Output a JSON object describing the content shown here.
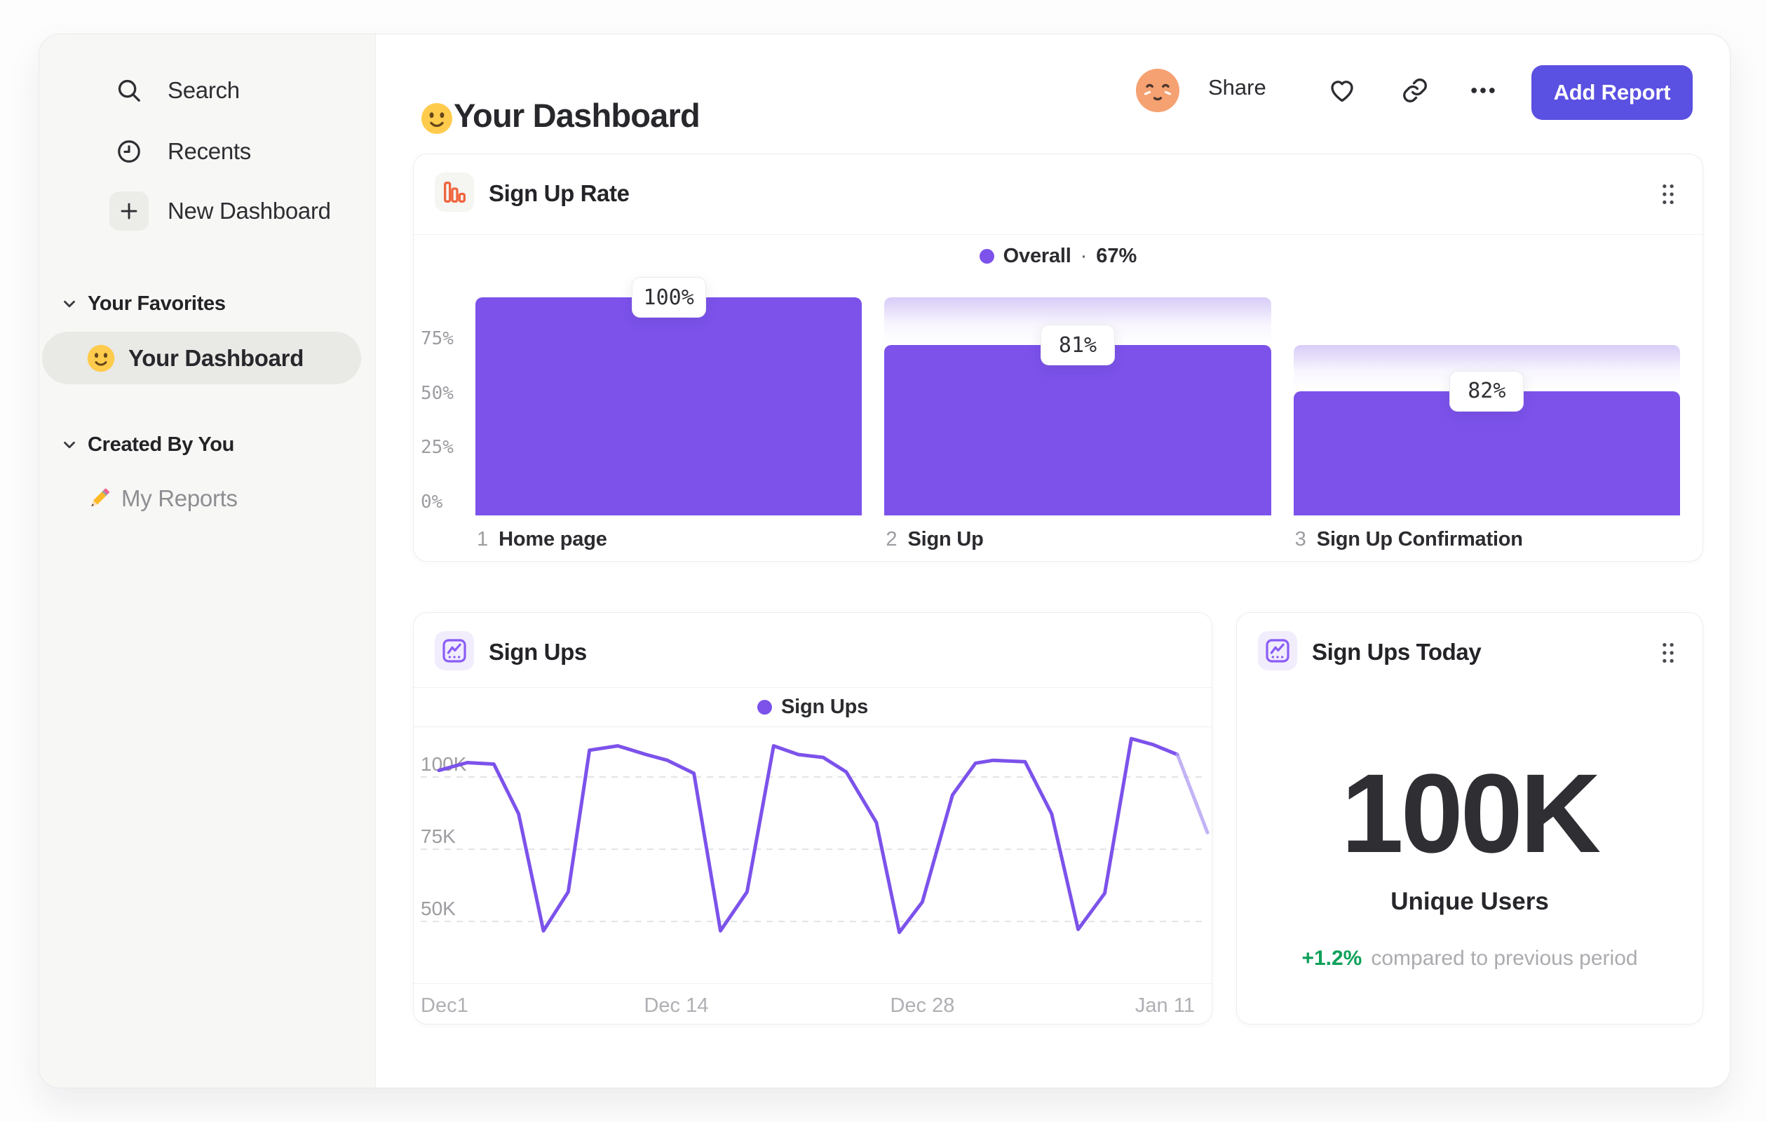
{
  "colors": {
    "purple": "#7C52EB",
    "indigo": "#5A50E1",
    "green": "#0EA05B",
    "orange": "#F0663F",
    "ghost_top": "#D8CCF8",
    "sidebar_bg": "#F7F7F5",
    "active_pill": "#E9E9E6"
  },
  "sidebar": {
    "nav": [
      {
        "label": "Search",
        "icon": "search-icon"
      },
      {
        "label": "Recents",
        "icon": "clock-icon"
      },
      {
        "label": "New Dashboard",
        "icon": "plus-icon"
      }
    ],
    "sections": [
      {
        "label": "Your Favorites",
        "items": [
          {
            "label": "Your Dashboard",
            "emoji": "slightly-smiling-face",
            "active": true
          }
        ]
      },
      {
        "label": "Created By You",
        "items": [
          {
            "label": "My Reports",
            "emoji": "pencil",
            "active": false
          }
        ]
      }
    ]
  },
  "header": {
    "emoji": "slightly-smiling-face",
    "title": "Your Dashboard",
    "share": "Share",
    "add_report": "Add Report"
  },
  "chart_data": [
    {
      "type": "bar",
      "title": "Sign Up Rate",
      "legend": {
        "label": "Overall",
        "sep": "·",
        "value": "67%"
      },
      "y_ticks": [
        "75%",
        "50%",
        "25%",
        "0%"
      ],
      "y_tick_fracs": [
        0.75,
        0.5,
        0.25,
        0
      ],
      "ylim": [
        0,
        100
      ],
      "steps": [
        {
          "num": "1",
          "label": "Home page",
          "value_label": "100%",
          "value": 100,
          "solid": 1.0,
          "ghost": null
        },
        {
          "num": "2",
          "label": "Sign Up",
          "value_label": "81%",
          "value": 81,
          "solid": 0.78,
          "ghost": 1.0
        },
        {
          "num": "3",
          "label": "Sign Up Confirmation",
          "value_label": "82%",
          "value": 82,
          "solid": 0.57,
          "ghost": 0.78
        }
      ],
      "bar_color": "#7C52EB"
    },
    {
      "type": "line",
      "title": "Sign Ups",
      "legend": {
        "label": "Sign Ups"
      },
      "x_domain": [
        0,
        43.4
      ],
      "y_domain": [
        28.4,
        117.2
      ],
      "y_ticks": [
        {
          "label": "100K",
          "value": 100
        },
        {
          "label": "75K",
          "value": 75
        },
        {
          "label": "50K",
          "value": 50
        }
      ],
      "x_ticks": [
        {
          "label": "Dec1",
          "day": 0,
          "align": "left"
        },
        {
          "label": "Dec 14",
          "day": 13.4
        },
        {
          "label": "Dec 28",
          "day": 27.3
        },
        {
          "label": "Jan 11",
          "day": 41
        }
      ],
      "unit": "K",
      "points": [
        [
          0,
          102
        ],
        [
          1.6,
          104.7
        ],
        [
          3.1,
          104.2
        ],
        [
          4.5,
          87
        ],
        [
          5.9,
          46.5
        ],
        [
          7.3,
          60
        ],
        [
          8.5,
          109
        ],
        [
          10.1,
          110.5
        ],
        [
          11.7,
          107.5
        ],
        [
          12.9,
          105.5
        ],
        [
          14.4,
          101
        ],
        [
          15.9,
          46.5
        ],
        [
          17.4,
          60
        ],
        [
          18.9,
          110.5
        ],
        [
          20.3,
          107.5
        ],
        [
          21.7,
          106.5
        ],
        [
          23,
          101.5
        ],
        [
          24.7,
          84
        ],
        [
          26,
          46
        ],
        [
          27.3,
          56.5
        ],
        [
          29,
          93.5
        ],
        [
          30.3,
          104.5
        ],
        [
          31.3,
          105.5
        ],
        [
          33.1,
          105
        ],
        [
          34.6,
          87
        ],
        [
          36.1,
          47
        ],
        [
          37.6,
          59.5
        ],
        [
          39.1,
          113
        ],
        [
          40.3,
          111
        ],
        [
          41.7,
          107.5
        ],
        [
          43.4,
          80.5
        ]
      ],
      "faded_tail_points": 2,
      "line_color": "#7C52EB"
    },
    {
      "type": "stat",
      "title": "Sign Ups Today",
      "value": "100K",
      "label": "Unique Users",
      "delta": "+1.2%",
      "delta_note": "compared to previous period"
    }
  ]
}
